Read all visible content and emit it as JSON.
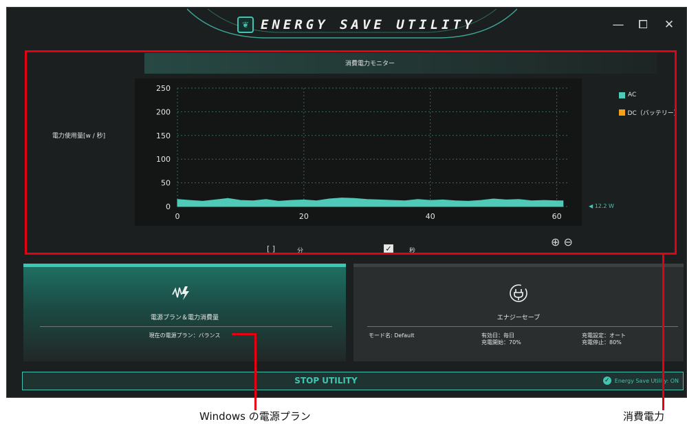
{
  "app": {
    "title": "ENERGY SAVE UTILITY",
    "logo": "leaf-icon"
  },
  "window_controls": {
    "minimize": "—",
    "maximize": "⧠",
    "close": "✕"
  },
  "monitor": {
    "title": "消費電力モニター",
    "ylabel": "電力使用量[w / 秒]",
    "current_value": "◀ 12.2 W",
    "unit_minute_box": "[ ]",
    "unit_minute": "分",
    "unit_second_box": "✓",
    "unit_second": "秒",
    "zoom_in": "⊕",
    "zoom_out": "⊖"
  },
  "chart_data": {
    "type": "area",
    "x": [
      0,
      2,
      4,
      6,
      8,
      10,
      12,
      14,
      16,
      18,
      20,
      22,
      24,
      26,
      28,
      30,
      32,
      34,
      36,
      38,
      40,
      42,
      44,
      46,
      48,
      50,
      52,
      54,
      56,
      58,
      60,
      61
    ],
    "series": [
      {
        "name": "AC",
        "values": [
          15,
          13,
          11,
          14,
          17,
          13,
          12,
          15,
          11,
          13,
          14,
          12,
          16,
          18,
          17,
          15,
          14,
          13,
          12,
          15,
          13,
          14,
          12,
          11,
          13,
          16,
          14,
          15,
          12,
          13,
          12,
          12
        ]
      },
      {
        "name": "DC (バッテリー)",
        "values": []
      }
    ],
    "xticks": [
      0,
      20,
      40,
      60
    ],
    "yticks": [
      0,
      50,
      100,
      150,
      200,
      250
    ],
    "xlim": [
      0,
      62
    ],
    "ylim": [
      0,
      250
    ],
    "colors": {
      "AC": "#4fc9b8",
      "DC (バッテリー)": "#f5a21a"
    },
    "grid": true,
    "legend": "right"
  },
  "legend": {
    "ac": "AC",
    "dc": "DC（バッテリー）"
  },
  "plan_panel": {
    "icon": "power-plan-icon",
    "heading": "電源プラン＆電力消費量",
    "current_plan": "現在の電源プラン：バランス"
  },
  "save_panel": {
    "icon": "plug-icon",
    "heading": "エナジーセーブ",
    "mode": "モード名: Default",
    "valid_day": "有効日：毎日",
    "charge_start": "充電開始：70%",
    "charge_setting": "充電設定：オート",
    "charge_stop": "充電停止：80%"
  },
  "footer": {
    "stop_label": "STOP UTILITY",
    "status": "Energy Save Utility: ON"
  },
  "annotations": {
    "plan_caption": "Windows の電源プラン",
    "power_caption": "消費電力"
  },
  "colors": {
    "accent": "#43c4b0",
    "highlight": "#e60012"
  }
}
